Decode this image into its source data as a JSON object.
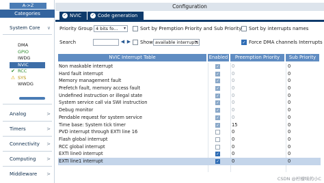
{
  "sidebar": {
    "sort_button": "A->Z",
    "categories_tab": "Categories",
    "system_core": "System Core",
    "core_items": [
      {
        "label": "DMA",
        "state": "none"
      },
      {
        "label": "GPIO",
        "state": "green"
      },
      {
        "label": "IWDG",
        "state": "none"
      },
      {
        "label": "NVIC",
        "state": "selected"
      },
      {
        "label": "RCC",
        "state": "check"
      },
      {
        "label": "SYS",
        "state": "warn"
      },
      {
        "label": "WWDG",
        "state": "none"
      }
    ],
    "sections": [
      "Analog",
      "Timers",
      "Connectivity",
      "Computing",
      "Middleware"
    ]
  },
  "main": {
    "title": "Configuration",
    "tabs": [
      {
        "label": "NVIC",
        "active": false
      },
      {
        "label": "Code generation",
        "active": true
      }
    ],
    "priority_group_label": "Priority Group",
    "priority_group_value": "4 bits fo...",
    "sort_premption_label": "Sort by Premption Priority and Sub Priority",
    "sort_interrupts_label": "Sort by interrupts names",
    "search_label": "Search",
    "show_label": "Show",
    "show_value": "available interrupts",
    "force_dma_label": "Force DMA channels Interrupts",
    "force_dma_checked": true
  },
  "table": {
    "headers": [
      "NVIC Interrupt Table",
      "Enabled",
      "Preemption Priority",
      "Sub Priority"
    ],
    "rows": [
      {
        "name": "Non maskable interrupt",
        "enabled": true,
        "locked": true,
        "pre": "0",
        "sub": "0"
      },
      {
        "name": "Hard fault interrupt",
        "enabled": true,
        "locked": true,
        "pre": "0",
        "sub": "0"
      },
      {
        "name": "Memory management fault",
        "enabled": true,
        "locked": true,
        "pre": "0",
        "sub": "0"
      },
      {
        "name": "Prefetch fault, memory access fault",
        "enabled": true,
        "locked": true,
        "pre": "0",
        "sub": "0"
      },
      {
        "name": "Undefined instruction or illegal state",
        "enabled": true,
        "locked": true,
        "pre": "0",
        "sub": "0"
      },
      {
        "name": "System service call via SWI instruction",
        "enabled": true,
        "locked": true,
        "pre": "0",
        "sub": "0"
      },
      {
        "name": "Debug monitor",
        "enabled": true,
        "locked": true,
        "pre": "0",
        "sub": "0"
      },
      {
        "name": "Pendable request for system service",
        "enabled": true,
        "locked": true,
        "pre": "0",
        "sub": "0"
      },
      {
        "name": "Time base: System tick timer",
        "enabled": true,
        "locked": true,
        "pre": "15",
        "sub": "0"
      },
      {
        "name": "PVD interrupt through EXTI line 16",
        "enabled": false,
        "locked": false,
        "pre": "0",
        "sub": "0"
      },
      {
        "name": "Flash global interrupt",
        "enabled": false,
        "locked": false,
        "pre": "0",
        "sub": "0"
      },
      {
        "name": "RCC global interrupt",
        "enabled": false,
        "locked": false,
        "pre": "0",
        "sub": "0"
      },
      {
        "name": "EXTI line0 interrupt",
        "enabled": true,
        "locked": false,
        "pre": "0",
        "sub": "0"
      },
      {
        "name": "EXTI line1 interrupt",
        "enabled": true,
        "locked": false,
        "pre": "0",
        "sub": "0",
        "selected": true
      }
    ]
  },
  "watermark": "CSDN @柠檬味的小C",
  "colors": {
    "navy_tab": "#0f3b6b",
    "header_blue": "#5f8cc2",
    "selection": "#c4d5ea",
    "green_item": "#2e8b2e"
  }
}
